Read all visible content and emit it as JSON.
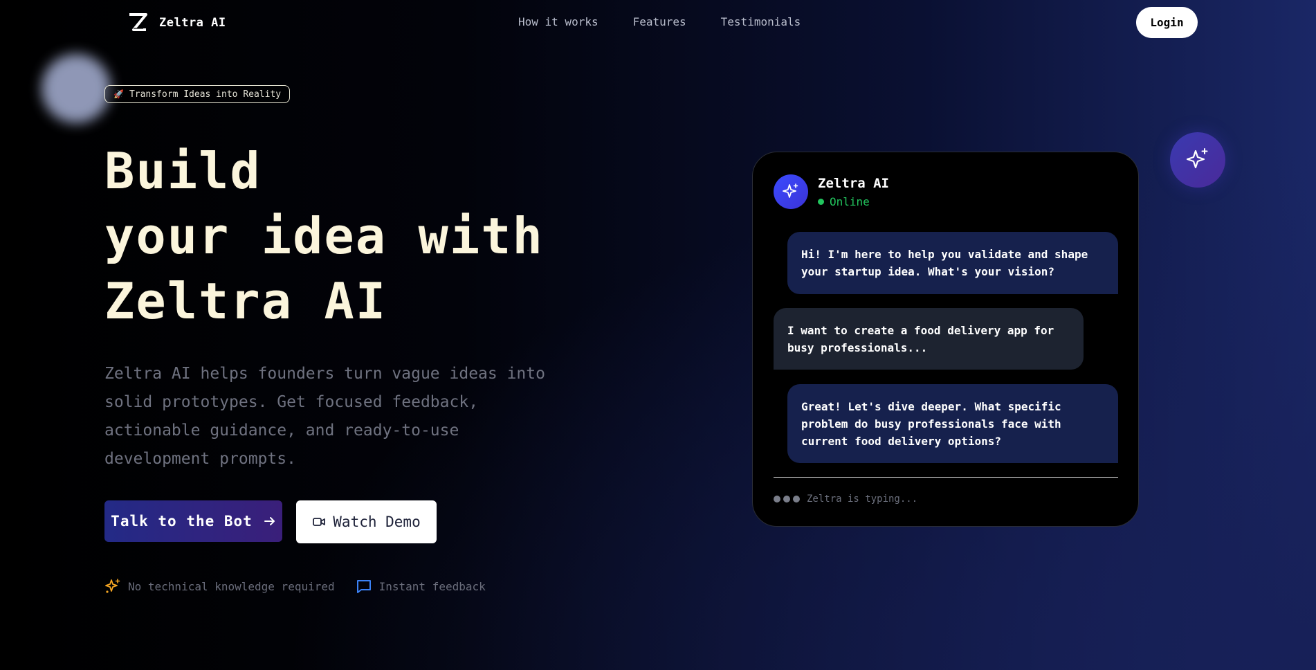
{
  "nav": {
    "brand_name": "Zeltra AI",
    "links": [
      "How it works",
      "Features",
      "Testimonials"
    ],
    "login_label": "Login"
  },
  "hero": {
    "badge_emoji": "🚀",
    "badge_text": "Transform Ideas into Reality",
    "title_lines": [
      "Build",
      "your idea with",
      "Zeltra AI"
    ],
    "description": "Zeltra AI helps founders turn vague ideas into solid prototypes. Get focused feedback, actionable guidance, and ready-to-use development prompts.",
    "primary_button": "Talk to the Bot",
    "secondary_button": "Watch Demo",
    "features": [
      {
        "icon": "sparkles-icon",
        "label": "No technical knowledge required"
      },
      {
        "icon": "message-square-icon",
        "label": "Instant feedback"
      }
    ]
  },
  "chat": {
    "name": "Zeltra AI",
    "status": "Online",
    "messages": [
      {
        "role": "bot",
        "text": "Hi! I'm here to help you validate and shape your startup idea. What's your vision?"
      },
      {
        "role": "user",
        "text": "I want to create a food delivery app for busy professionals..."
      },
      {
        "role": "bot",
        "text": "Great! Let's dive deeper. What specific problem do busy professionals face with current food delivery options?"
      }
    ],
    "typing_text": "Zeltra is typing..."
  },
  "colors": {
    "accent_blue": "#3b4bff",
    "online_green": "#22c55e",
    "title_cream": "#fbf5dc",
    "feature_sparkle": "#f5a623",
    "feature_message": "#3b82f6"
  }
}
